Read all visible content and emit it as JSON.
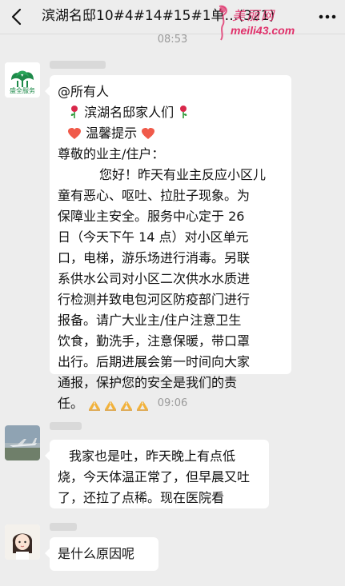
{
  "header": {
    "title": "滨湖名邸10#4#14#15#1单…(321)",
    "back_icon": "chevron-left-icon",
    "more_icon": "more-dots-icon"
  },
  "watermark": {
    "top_text": "美丽网",
    "bottom_text": "meili43.com",
    "color": "#e0306a"
  },
  "timestamps": [
    "08:53",
    "09:06"
  ],
  "messages": [
    {
      "sender_avatar": "shengquan-logo",
      "avatar_text": "盛全服务",
      "lines": [
        "@所有人",
        "滨湖名邸家人们",
        "温馨提示",
        "尊敬的业主/住户：",
        "您好！昨天有业主反应小区儿",
        "童有恶心、呕吐、拉肚子现象。为",
        "保障业主安全。服务中心定于 26",
        "日（今天下午 14 点）对小区单元",
        "口，电梯，游乐场进行消毒。另联",
        "系供水公司对小区二次供水水质进",
        "行检测并致电包河区防疫部门进行",
        "报备。请广大业主/住户注意卫生",
        "饮食，勤洗手，注意保暖，带口罩",
        "出行。后期进展会第一时间向大家",
        "通报，保护您的安全是我们的责",
        "任。"
      ]
    },
    {
      "sender_avatar": "airplane-photo",
      "lines": [
        "我家也是吐，昨天晚上有点低",
        "烧，今天体温正常了，但早晨又吐",
        "了，还拉了点稀。现在医院看"
      ]
    },
    {
      "sender_avatar": "cartoon-girl",
      "lines": [
        "是什么原因呢"
      ]
    }
  ],
  "colors": {
    "background": "#ededed",
    "bubble": "#ffffff",
    "time_text": "#9a9a9a",
    "logo_green": "#1e8a4a"
  }
}
